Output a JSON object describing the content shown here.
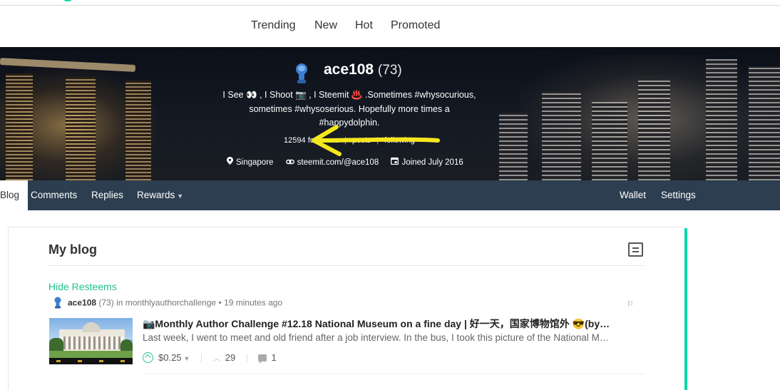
{
  "topnav": {
    "items": [
      "Trending",
      "New",
      "Hot",
      "Promoted"
    ]
  },
  "profile": {
    "name": "ace108",
    "reputation": "(73)",
    "about_lines": [
      "I See 👀 , I Shoot 📷 , I Steemit ♨️ .Sometimes #whysocurious,",
      "sometimes #whysoserious. Hopefully more times a",
      "#happydolphin."
    ],
    "stats": {
      "followers": "12594 followers",
      "posts": "posts",
      "following": "following"
    },
    "location": "Singapore",
    "website": "steemit.com/@ace108",
    "joined": "Joined July 2016",
    "icons": [
      "location-pin-icon",
      "link-icon",
      "calendar-icon"
    ]
  },
  "subnav": {
    "left_tabs": [
      "Blog",
      "Comments",
      "Replies",
      "Rewards"
    ],
    "right_tabs": [
      "Wallet",
      "Settings"
    ]
  },
  "blog": {
    "title": "My blog",
    "hide_resteems": "Hide Resteems",
    "post": {
      "author": "ace108",
      "author_rep": "(73)",
      "in_text": "in",
      "community": "monthlyauthorchallenge",
      "time": "• 19 minutes ago",
      "title": "📷Monthly Author Challenge #12.18 National Museum on a fine day | 好一天，国家博物馆外 😎(by…",
      "excerpt": "Last week, I went to meet and old friend after a job interview. In the bus, I took this picture of the National M…",
      "payout": "$0.25",
      "votes": "29",
      "comments": "1"
    }
  },
  "colors": {
    "accent": "#06d6a9",
    "subnav_bg": "#2c3e50",
    "arrow": "#f5e61d"
  }
}
